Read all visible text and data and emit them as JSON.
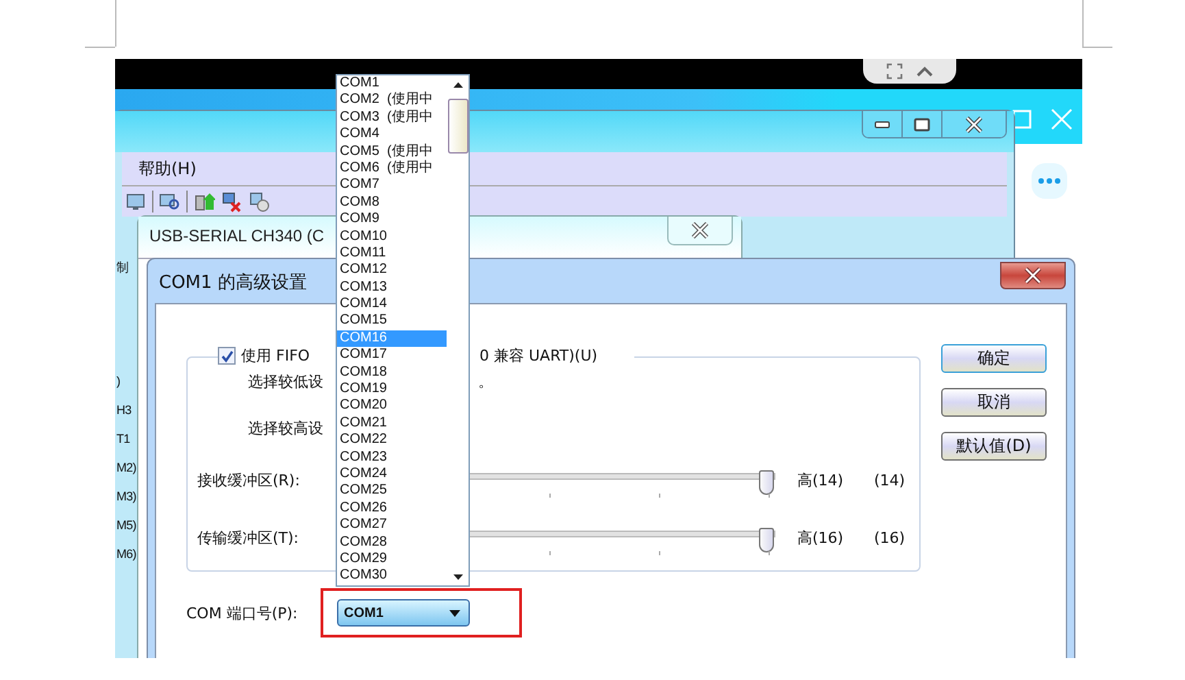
{
  "main_window": {
    "menu": [
      "帮助(H)"
    ],
    "side_labels": [
      "制",
      ")",
      "H3",
      "T1",
      "M2)",
      "M3)",
      "M5)",
      "M6)"
    ]
  },
  "properties_dialog": {
    "title": "USB-SERIAL CH340 (C"
  },
  "advanced_dialog": {
    "title": "COM1 的高级设置",
    "fifo": {
      "checked": true,
      "label": "使用 FIFO",
      "label_tail": "0 兼容 UART)(U)"
    },
    "notes": [
      {
        "text": "选择较低设",
        "tail": "。"
      },
      {
        "text": "选择较高设"
      }
    ],
    "sliders": [
      {
        "label": "接收缓冲区(R):",
        "level": 1,
        "value": "高(14)",
        "reading": "(14)"
      },
      {
        "label": "传输缓冲区(T):",
        "level": 1,
        "value": "高(16)",
        "reading": "(16)"
      }
    ],
    "buttons": [
      "确定",
      "取消",
      "默认值(D)"
    ],
    "port": {
      "label": "COM 端口号(P):",
      "value": "COM1"
    }
  },
  "port_list": [
    {
      "label": "COM1",
      "selected": false
    },
    {
      "label": "COM2",
      "note": "(使用中",
      "selected": false
    },
    {
      "label": "COM3",
      "note": "(使用中",
      "selected": false
    },
    {
      "label": "COM4",
      "selected": false
    },
    {
      "label": "COM5",
      "note": "(使用中",
      "selected": false
    },
    {
      "label": "COM6",
      "note": "(使用中",
      "selected": false
    },
    {
      "label": "COM7",
      "selected": false
    },
    {
      "label": "COM8",
      "selected": false
    },
    {
      "label": "COM9",
      "selected": false
    },
    {
      "label": "COM10",
      "selected": false
    },
    {
      "label": "COM11",
      "selected": false
    },
    {
      "label": "COM12",
      "selected": false
    },
    {
      "label": "COM13",
      "selected": false
    },
    {
      "label": "COM14",
      "selected": false
    },
    {
      "label": "COM15",
      "selected": false
    },
    {
      "label": "COM16",
      "selected": true
    },
    {
      "label": "COM17",
      "selected": false
    },
    {
      "label": "COM18",
      "selected": false
    },
    {
      "label": "COM19",
      "selected": false
    },
    {
      "label": "COM20",
      "selected": false
    },
    {
      "label": "COM21",
      "selected": false
    },
    {
      "label": "COM22",
      "selected": false
    },
    {
      "label": "COM23",
      "selected": false
    },
    {
      "label": "COM24",
      "selected": false
    },
    {
      "label": "COM25",
      "selected": false
    },
    {
      "label": "COM26",
      "selected": false
    },
    {
      "label": "COM27",
      "selected": false
    },
    {
      "label": "COM28",
      "selected": false
    },
    {
      "label": "COM29",
      "selected": false
    },
    {
      "label": "COM30",
      "selected": false
    }
  ]
}
